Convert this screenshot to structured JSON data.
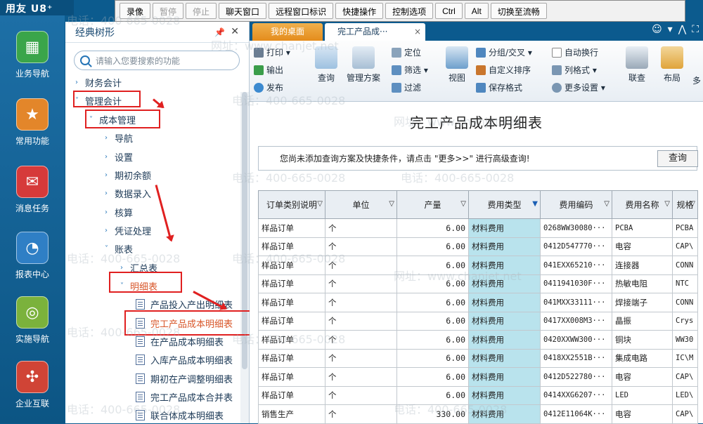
{
  "app": {
    "logo": "用友 U8⁺"
  },
  "toolbar": {
    "buttons": [
      {
        "label": "录像",
        "enabled": true
      },
      {
        "label": "暂停",
        "enabled": false
      },
      {
        "label": "停止",
        "enabled": false
      },
      {
        "label": "聊天窗口",
        "enabled": true
      },
      {
        "label": "远程窗口标识",
        "enabled": true
      },
      {
        "label": "快捷操作",
        "enabled": true
      },
      {
        "label": "控制选项",
        "enabled": true
      },
      {
        "label": "Ctrl",
        "enabled": true
      },
      {
        "label": "Alt",
        "enabled": true
      },
      {
        "label": "切换至流畅",
        "enabled": true
      }
    ]
  },
  "leftnav": {
    "items": [
      {
        "label": "业务导航",
        "icon": "business-nav-icon",
        "color": "#3aa54a"
      },
      {
        "label": "常用功能",
        "icon": "star-icon",
        "color": "#e3862a"
      },
      {
        "label": "消息任务",
        "icon": "mail-icon",
        "color": "#d63a3a"
      },
      {
        "label": "报表中心",
        "icon": "report-icon",
        "color": "#2f7fc5"
      },
      {
        "label": "实施导航",
        "icon": "compass-icon",
        "color": "#7bb23c"
      },
      {
        "label": "企业互联",
        "icon": "connect-icon",
        "color": "#d04436"
      }
    ]
  },
  "sidebar": {
    "title": "经典树形",
    "search_placeholder": "请输入您要搜索的功能",
    "tree": [
      {
        "label": "财务会计",
        "arrow": "›"
      },
      {
        "label": "管理会计",
        "arrow": "˅"
      },
      {
        "label": "成本管理",
        "arrow": "˅"
      },
      {
        "label": "导航",
        "arrow": "›"
      },
      {
        "label": "设置",
        "arrow": "›"
      },
      {
        "label": "期初余额",
        "arrow": "›"
      },
      {
        "label": "数据录入",
        "arrow": "›"
      },
      {
        "label": "核算",
        "arrow": "›"
      },
      {
        "label": "凭证处理",
        "arrow": "›"
      },
      {
        "label": "账表",
        "arrow": "˅"
      },
      {
        "label": "汇总表",
        "arrow": "›"
      },
      {
        "label": "明细表",
        "arrow": "˅"
      },
      {
        "label": "产品投入产出明细表"
      },
      {
        "label": "完工产品成本明细表"
      },
      {
        "label": "在产品成本明细表"
      },
      {
        "label": "入库产品成本明细表"
      },
      {
        "label": "期初在产调整明细表"
      },
      {
        "label": "完工产品成本合并表"
      },
      {
        "label": "联合体成本明细表"
      }
    ]
  },
  "tabs": {
    "home": "我的桌面",
    "active": "完工产品成···"
  },
  "ribbon": {
    "print": "打印",
    "export": "输出",
    "publish": "发布",
    "query": "查询",
    "scheme": "管理方案",
    "locate": "定位",
    "filter": "筛选",
    "filter2": "过滤",
    "view": "视图",
    "group": "分组/交叉",
    "autowrap": "自动换行",
    "custom_sort": "自定义排序",
    "colformat": "列格式",
    "save_format": "保存格式",
    "more_settings": "更多设置",
    "link": "联查",
    "layout": "布局",
    "more": "多"
  },
  "report": {
    "title": "完工产品成本明细表",
    "hint": "您尚未添加查询方案及快捷条件，请点击 \"更多>>\" 进行高级查询!",
    "query_btn": "查询"
  },
  "table": {
    "columns": [
      "订单类别说明",
      "单位",
      "产量",
      "费用类型",
      "费用编码",
      "费用名称",
      "规格"
    ],
    "rows": [
      [
        "样品订单",
        "个",
        "6.00",
        "材料费用",
        "0268WW30080···",
        "PCBA",
        "PCBA"
      ],
      [
        "样品订单",
        "个",
        "6.00",
        "材料费用",
        "0412D547770···",
        "电容",
        "CAP\\"
      ],
      [
        "样品订单",
        "个",
        "6.00",
        "材料费用",
        "041EXX65210···",
        "连接器",
        "CONN"
      ],
      [
        "样品订单",
        "个",
        "6.00",
        "材料费用",
        "0411941030F···",
        "热敏电阻",
        "NTC"
      ],
      [
        "样品订单",
        "个",
        "6.00",
        "材料费用",
        "041MXX33111···",
        "焊接端子",
        "CONN"
      ],
      [
        "样品订单",
        "个",
        "6.00",
        "材料费用",
        "0417XX008M3···",
        "晶振",
        "Crys"
      ],
      [
        "样品订单",
        "个",
        "6.00",
        "材料费用",
        "0420XXWW300···",
        "铜块",
        "WW30"
      ],
      [
        "样品订单",
        "个",
        "6.00",
        "材料费用",
        "0418XX2551B···",
        "集成电路",
        "IC\\M"
      ],
      [
        "样品订单",
        "个",
        "6.00",
        "材料费用",
        "0412D522780···",
        "电容",
        "CAP\\"
      ],
      [
        "样品订单",
        "个",
        "6.00",
        "材料费用",
        "0414XXG6207···",
        "LED",
        "LED\\"
      ],
      [
        "销售生产",
        "个",
        "330.00",
        "材料费用",
        "0412E11064K···",
        "电容",
        "CAP\\"
      ]
    ]
  },
  "watermark": {
    "phone": "电话：400-665-0028",
    "site": "网址：www.chanjet.net"
  }
}
